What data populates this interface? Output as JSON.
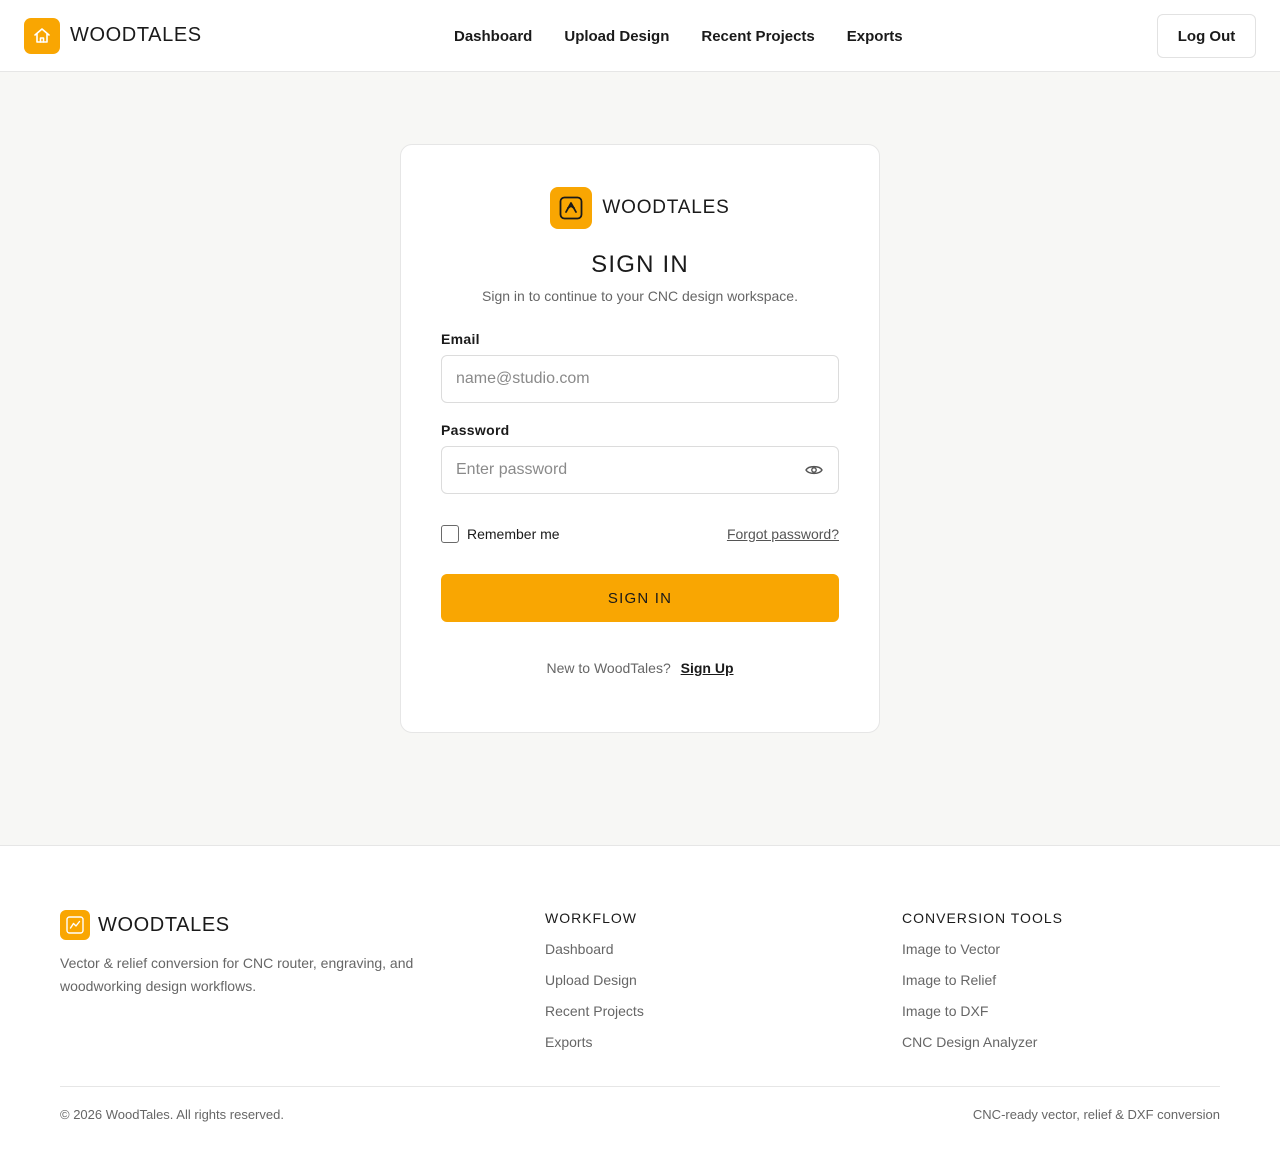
{
  "brand": {
    "name": "WOODTALES",
    "accent_color": "#f9a602"
  },
  "header": {
    "nav": [
      {
        "label": "Dashboard"
      },
      {
        "label": "Upload Design"
      },
      {
        "label": "Recent Projects"
      },
      {
        "label": "Exports"
      }
    ],
    "logout_label": "Log Out",
    "logo_icon": "house-icon"
  },
  "signin": {
    "brand": "WOODTALES",
    "logo_icon": "pen-frame-icon",
    "title": "SIGN IN",
    "subtitle": "Sign in to continue to your CNC design workspace.",
    "email_label": "Email",
    "email_placeholder": "name@studio.com",
    "email_value": "",
    "password_label": "Password",
    "password_placeholder": "Enter password",
    "password_value": "",
    "password_toggle_icon": "eye-icon",
    "remember_label": "Remember me",
    "remember_checked": false,
    "forgot_label": "Forgot password?",
    "submit_label": "SIGN IN",
    "new_user_text": "New to WoodTales?",
    "signup_label": "Sign Up"
  },
  "footer": {
    "brand": "WOODTALES",
    "logo_icon": "chart-frame-icon",
    "description": "Vector & relief conversion for CNC router, engraving, and woodworking design workflows.",
    "columns": [
      {
        "heading": "WORKFLOW",
        "links": [
          "Dashboard",
          "Upload Design",
          "Recent Projects",
          "Exports"
        ]
      },
      {
        "heading": "CONVERSION TOOLS",
        "links": [
          "Image to Vector",
          "Image to Relief",
          "Image to DXF",
          "CNC Design Analyzer"
        ]
      }
    ],
    "copyright": "© 2026 WoodTales. All rights reserved.",
    "tagline": "CNC-ready vector, relief & DXF conversion"
  }
}
